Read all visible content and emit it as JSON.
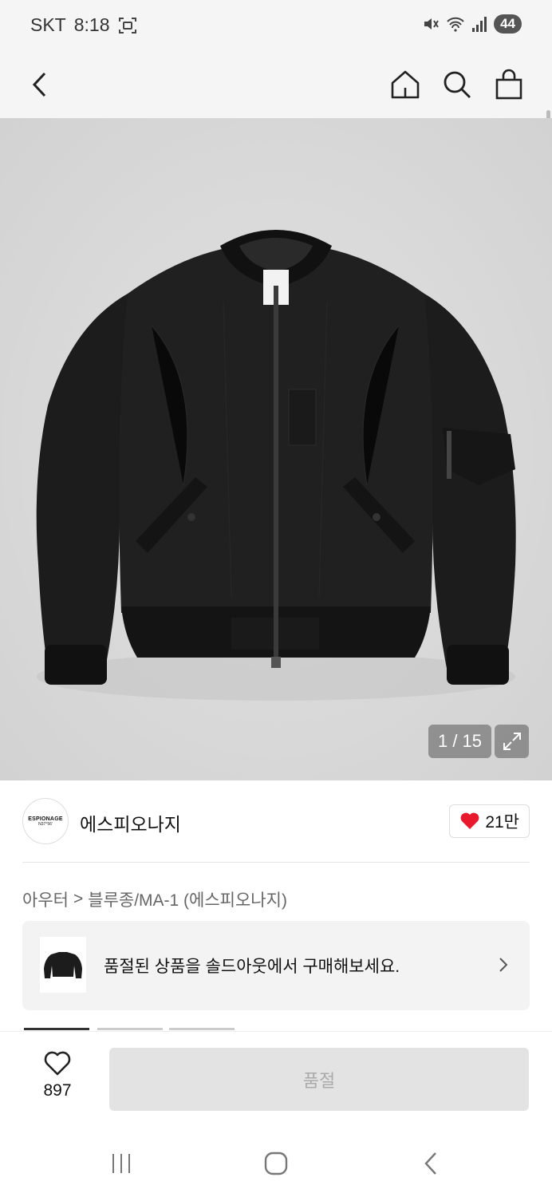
{
  "status_bar": {
    "carrier": "SKT",
    "time": "8:18",
    "battery": "44"
  },
  "product": {
    "image_counter": "1 / 15",
    "brand_name": "에스피오나지",
    "brand_logo_text": "ESPIONAGE",
    "brand_logo_sub": "N37°56'",
    "brand_likes": "21만",
    "breadcrumb": {
      "category": "아우터",
      "separator": ">",
      "subcategory": "블루종/MA-1 (에스피오나지)"
    },
    "soldout_banner_text": "품절된 상품을 솔드아웃에서 구매해보세요."
  },
  "bottom_bar": {
    "wish_count": "897",
    "action_label": "품절"
  },
  "icons": {
    "back": "back-arrow-icon",
    "home": "home-icon",
    "search": "search-icon",
    "cart": "shopping-bag-icon",
    "expand": "expand-icon",
    "heart": "heart-icon"
  },
  "colors": {
    "like_heart": "#e8192c",
    "soldout_button_bg": "#e3e3e3"
  }
}
